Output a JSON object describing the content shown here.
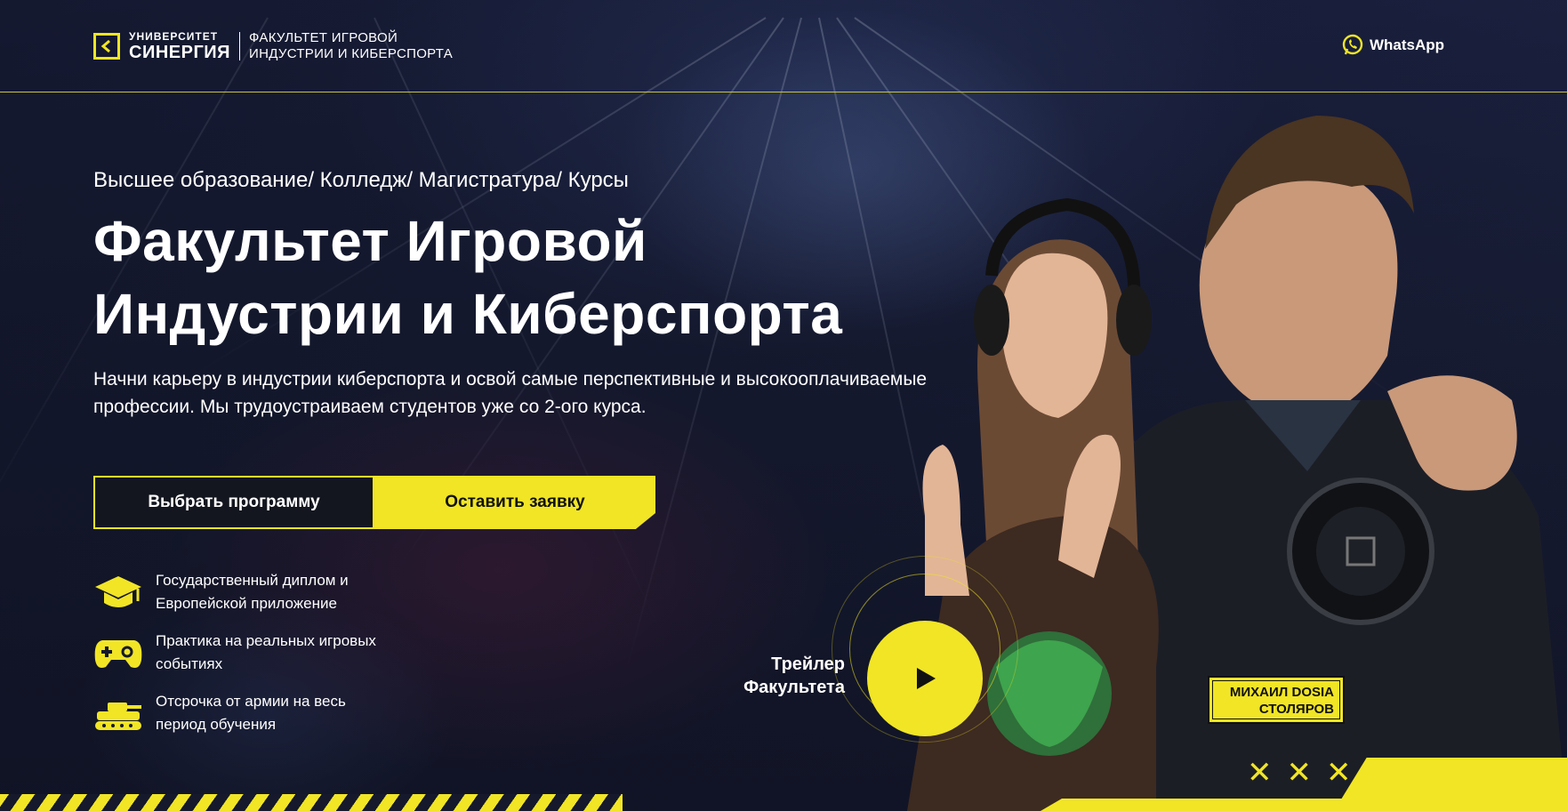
{
  "header": {
    "logo_line1": "УНИВЕРСИТЕТ",
    "logo_line2": "СИНЕРГИЯ",
    "faculty_line1": "ФАКУЛЬТЕТ ИГРОВОЙ",
    "faculty_line2": "ИНДУСТРИИ И КИБЕРСПОРТА",
    "whatsapp_label": "WhatsApp"
  },
  "hero": {
    "tags": "Высшее образование/ Колледж/ Магистратура/ Курсы",
    "title_line1": "Факультет Игровой",
    "title_line2": "Индустрии и Киберспорта",
    "description": "Начни карьеру в индустрии киберспорта и освой самые перспективные и высокооплачиваемые профессии. Мы трудоустраиваем студентов уже со 2-ого курса.",
    "button_program": "Выбрать программу",
    "button_apply": "Оставить заявку"
  },
  "features": [
    {
      "icon": "graduation-cap-icon",
      "line1": "Государственный диплом и",
      "line2": "Европейской приложение"
    },
    {
      "icon": "gamepad-icon",
      "line1": "Практика на реальных игровых",
      "line2": "событиях"
    },
    {
      "icon": "tank-icon",
      "line1": "Отсрочка от армии на весь",
      "line2": "период обучения"
    }
  ],
  "trailer": {
    "line1": "Трейлер",
    "line2": "Факультета"
  },
  "badge": {
    "line1_prefix": "МИХАИЛ ",
    "line1_nick": "DOSIA",
    "line2": "СТОЛЯРОВ"
  },
  "colors": {
    "accent": "#f1e526",
    "dark": "#14161f"
  }
}
